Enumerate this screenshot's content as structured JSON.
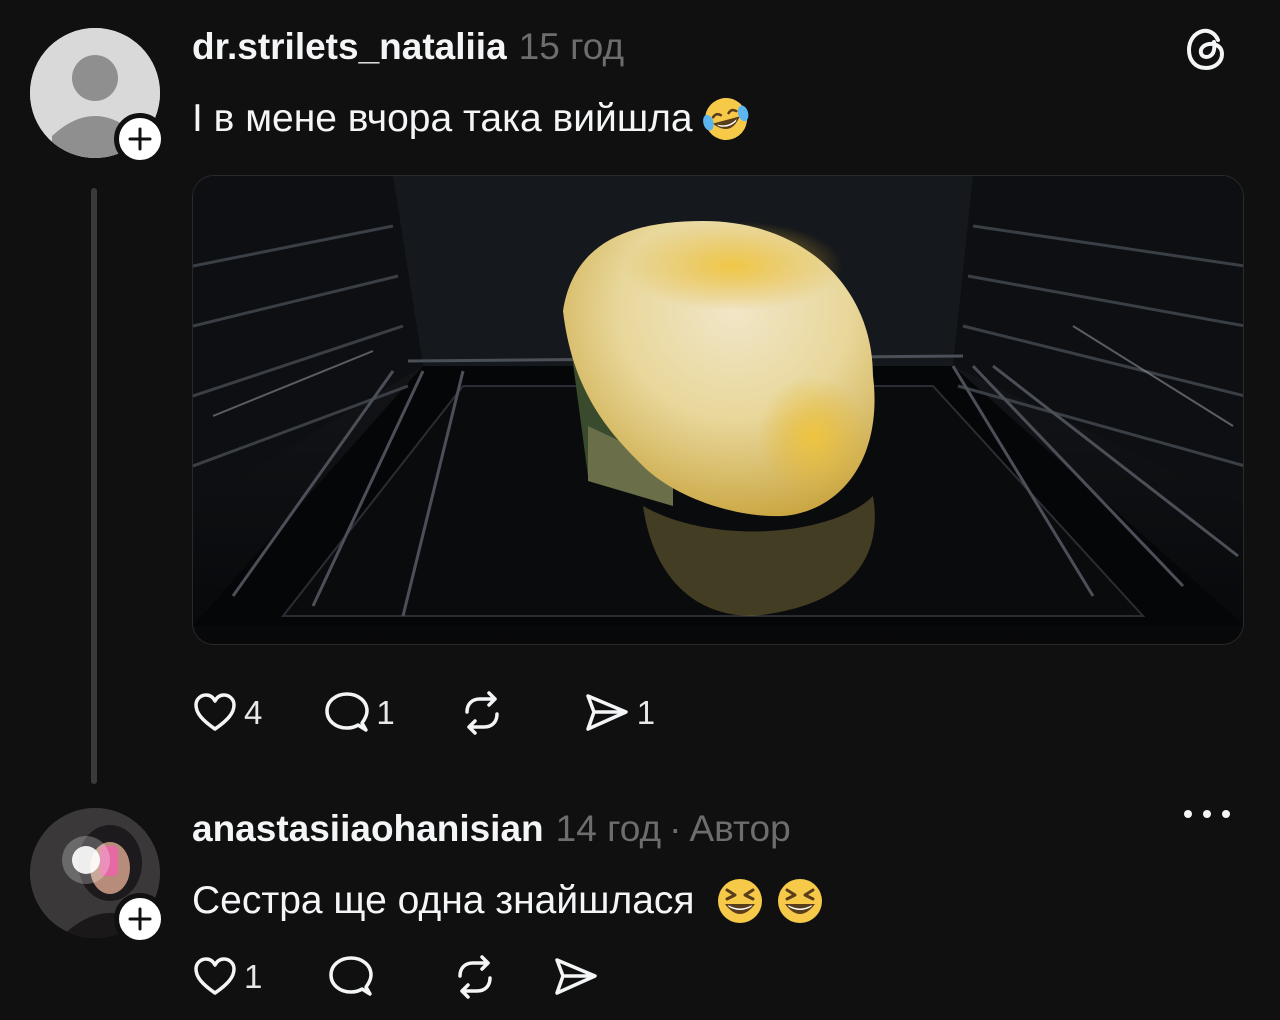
{
  "posts": [
    {
      "username": "dr.strilets_nataliia",
      "time": "15 год",
      "text": "І в мене вчора така вийшла",
      "text_emoji": "rolling-on-floor-laughing-emoji",
      "media_icon": "loaf-in-oven-photo",
      "corner_icon": "threads-logo-icon",
      "likes": "4",
      "replies": "1",
      "reposts": "",
      "shares": "1"
    },
    {
      "username": "anastasiiaohanisian",
      "time": "14 год",
      "author_badge": "Автор",
      "text": "Сестра ще одна знайшлася",
      "text_emoji": "grinning-squinting-face-emoji",
      "corner_icon": "more-options-icon",
      "likes": "1",
      "replies": "",
      "reposts": "",
      "shares": ""
    }
  ],
  "colors": {
    "background": "#101010",
    "text": "#f3f5f7",
    "secondary": "#6d6d6d",
    "thread_line": "#3a3a3a"
  }
}
